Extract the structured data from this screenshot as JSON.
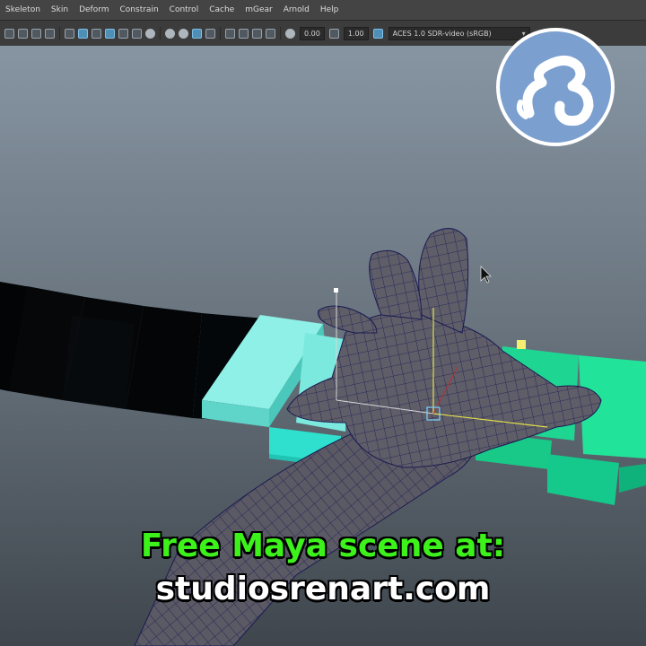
{
  "menu": {
    "items": [
      "Skeleton",
      "Skin",
      "Deform",
      "Constrain",
      "Control",
      "Cache",
      "mGear",
      "Arnold",
      "Help"
    ]
  },
  "toolbar": {
    "field1_value": "0.00",
    "field2_value": "1.00",
    "color_management": "ACES 1.0 SDR-video (sRGB)"
  },
  "caption": {
    "line1": "Free Maya scene at:",
    "line2": "studiosrenart.com"
  },
  "colors": {
    "caption_green": "#3df21b",
    "logo_blue": "#7b9fcf",
    "key_teal": "#7fe7dd",
    "key_green": "#22d894",
    "mesh_gray": "#5d5c66"
  }
}
